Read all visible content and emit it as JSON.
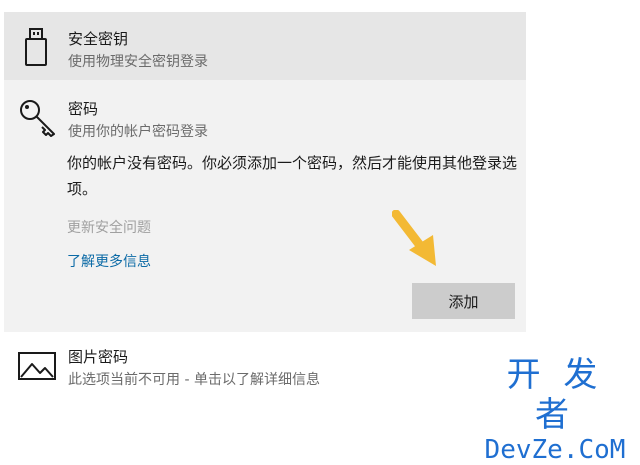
{
  "options": {
    "security_key": {
      "title": "安全密钥",
      "subtitle": "使用物理安全密钥登录",
      "icon": "usb-key-icon"
    },
    "password": {
      "title": "密码",
      "subtitle": "使用你的帐户密码登录",
      "icon": "key-icon",
      "description": "你的帐户没有密码。你必须添加一个密码，然后才能使用其他登录选项。",
      "update_link": "更新安全问题",
      "learn_more_link": "了解更多信息",
      "add_button": "添加",
      "pointer_icon": "arrow-pointer-icon",
      "pointer_color": "#f3b934"
    },
    "picture_password": {
      "title": "图片密码",
      "subtitle": "此选项当前不可用 - 单击以了解详细信息",
      "icon": "picture-icon"
    }
  },
  "watermark": {
    "line1": "开 发 者",
    "line2": "DevZe.CoM",
    "color": "#1f6fd1"
  }
}
